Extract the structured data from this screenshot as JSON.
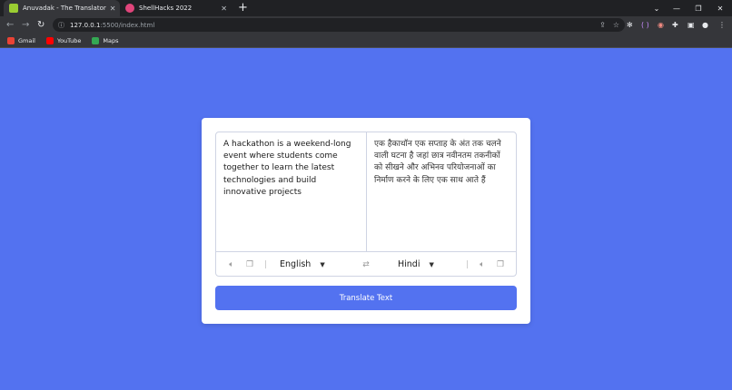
{
  "browser": {
    "tabs": [
      {
        "title": "Anuvadak - The Translator",
        "favicon_color": "#9acd32"
      },
      {
        "title": "ShellHacks 2022",
        "favicon_color": "#e0457b"
      }
    ],
    "new_tab": "+",
    "url": {
      "host": "127.0.0.1",
      "path": ":5500/index.html"
    },
    "bookmarks": [
      {
        "label": "Gmail",
        "color": "#ea4335"
      },
      {
        "label": "YouTube",
        "color": "#ff0000"
      },
      {
        "label": "Maps",
        "color": "#34a853"
      }
    ]
  },
  "translator": {
    "source_text": "A hackathon is a weekend-long event where students come together to learn the latest technologies and build innovative projects",
    "target_text": "एक हैकाथॉन एक सप्ताह के अंत तक चलने वाली घटना है जहां छात्र नवीनतम तकनीकों को सीखने और अभिनव परियोजनाओं का निर्माण करने के लिए एक साथ आते हैं",
    "from_language": "English",
    "to_language": "Hindi",
    "button_label": "Translate Text"
  },
  "colors": {
    "page_bg": "#5372f0",
    "button": "#5372f0"
  }
}
